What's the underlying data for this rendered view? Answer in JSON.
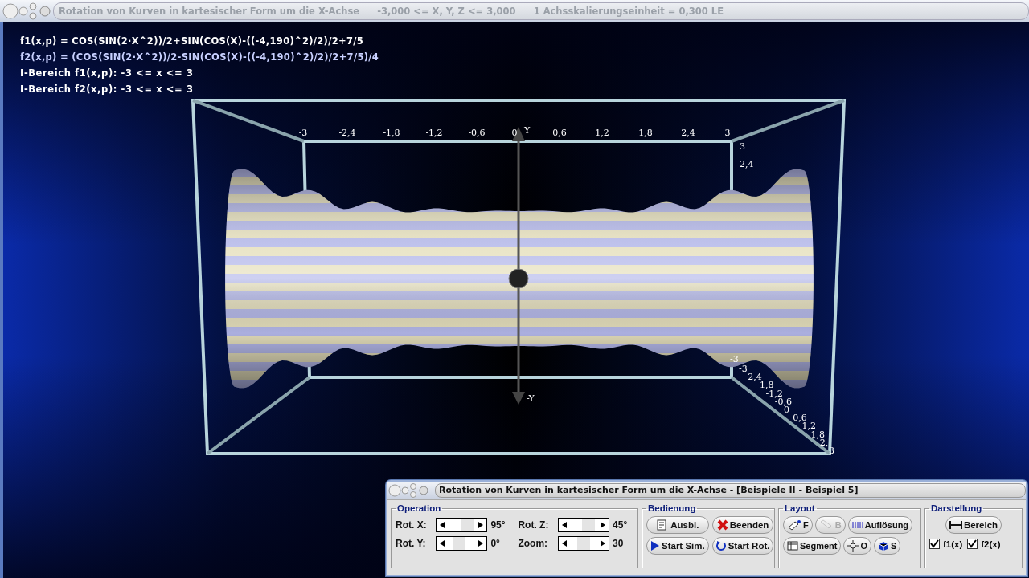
{
  "window": {
    "title": "Rotation von Kurven in kartesischer Form um die X-Achse",
    "range": "-3,000 <= X, Y, Z <= 3,000",
    "scale": "1 Achsskalierungseinheit = 0,300 LE"
  },
  "formulas": [
    {
      "text": "f1(x,p) = COS(SIN(2·X^2))/2+SIN(COS(X)-((-4,190)^2)/2)/2+7/5",
      "kind": "f1"
    },
    {
      "text": "f2(x,p) = (COS(SIN(2·X^2))/2-SIN(COS(X)-((-4,190)^2)/2)/2+7/5)/4",
      "kind": "f2"
    },
    {
      "text": "I-Bereich f1(x,p): -3 <= x <= 3",
      "kind": "range"
    },
    {
      "text": "I-Bereich f2(x,p): -3 <= x <= 3",
      "kind": "range"
    }
  ],
  "plot": {
    "x_ticks": [
      "-3",
      "-2,4",
      "-1,8",
      "-1,2",
      "-0,6",
      "0",
      "0,6",
      "1,2",
      "1,8",
      "2,4",
      "3"
    ],
    "y_ticks": [
      "3",
      "2,4",
      "-3"
    ],
    "z_ticks": [
      "-3",
      "2,4",
      "-1,8",
      "-1,2",
      "-0,6",
      "0",
      "0,6",
      "1,2",
      "1,8",
      "2,",
      "3"
    ],
    "axis_labels": [
      "Y",
      "-Y"
    ]
  },
  "panel": {
    "title": "Rotation von Kurven in kartesischer Form um die X-Achse - [Beispiele II - Beispiel 5]",
    "operation": {
      "title": "Operation",
      "sliders": [
        {
          "label": "Rot. X:",
          "level": 0.6,
          "reading": "95°"
        },
        {
          "label": "Rot. Z:",
          "level": 0.6,
          "reading": "45°"
        },
        {
          "label": "Rot. Y:",
          "level": 0.45,
          "reading": "0°"
        },
        {
          "label": "Zoom:",
          "level": 0.5,
          "reading": "30"
        }
      ]
    },
    "bedienung": {
      "title": "Bedienung",
      "buttons": [
        {
          "label": "Ausbl.",
          "disabled": false
        },
        {
          "label": "Beenden",
          "disabled": false
        },
        {
          "label": "Start Sim.",
          "disabled": false
        },
        {
          "label": "Start Rot.",
          "disabled": false
        }
      ]
    },
    "layout": {
      "title": "Layout",
      "buttons": [
        {
          "label": "F",
          "disabled": false
        },
        {
          "label": "B",
          "disabled": true
        },
        {
          "label": "Auflösung",
          "disabled": false
        },
        {
          "label": "Segment",
          "disabled": false
        },
        {
          "label": "O",
          "disabled": false
        },
        {
          "label": "S",
          "disabled": false
        }
      ]
    },
    "darstellung": {
      "title": "Darstellung",
      "button": "Bereich",
      "checkboxes": [
        {
          "label": "f1(x)",
          "checked": true
        },
        {
          "label": "f2(x)",
          "checked": true
        }
      ]
    }
  }
}
